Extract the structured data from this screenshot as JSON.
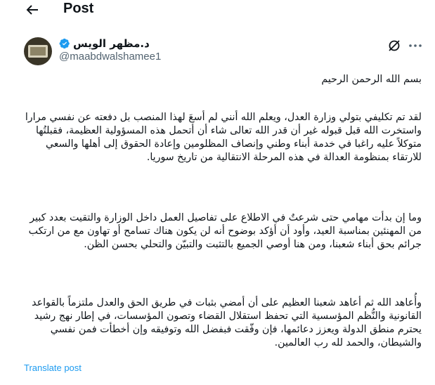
{
  "header": {
    "title": "Post"
  },
  "author": {
    "name": "د.مظهر الويس",
    "handle": "@maabdwalshamee1",
    "verified": true
  },
  "post": {
    "paragraphs": [
      "بسم الله الرحمن الرحيم",
      "لقد تم تكليفي بتولي وزارة العدل، ويعلم الله أنني لم أسعَ لهذا المنصب بل دفعته عن نفسي مرارا واستخرت الله قبل قبوله غير أن قدر الله تعالى شاء أن أتحمل هذه المسؤولية العظيمة، فقبلتُها متوكلاً عليه راغبا في خدمة أبناء وطني وإنصاف المظلومين وإعادة الحقوق إلى أهلها والسعي للارتقاء بمنظومة العدالة في هذه المرحلة الانتقالية من تاريخ سوريا.",
      "وما إن بدأت مهامي حتى شرعتٌ في الاطلاع على تفاصيل العمل داخل الوزارة والتقيت بعدد كبير من المهنئين بمناسبة العيد، وأود أن أؤكد بوضوح أنه لن يكون هناك تسامح أو تهاون مع من ارتكب جرائم بحق أبناء شعبنا، ومن هنا أوصي الجميع بالتثبت والتبيّن والتحلي بحسن الظن.",
      "وأُعاهد الله ثم أعاهد شعبنا العظيم على أن أمضي بثبات في طريق الحق والعدل ملتزماً بالقواعد القانونية والنُّظم المؤسسية التي تحفظ استقلال القضاء وتصون المؤسسات، في إطار نهج رشيد يحترم منطق الدولة ويعزز دعائمها، فإن وفّقت فبفضل الله وتوفيقه وإن أخطأت فمن نفسي والشيطان، والحمد لله رب العالمين."
    ]
  },
  "actions": {
    "translate_label": "Translate post"
  },
  "icons": {
    "back": "arrow-left-icon",
    "verified": "verified-badge-icon",
    "grok": "grok-icon",
    "more": "more-horizontal-icon"
  },
  "colors": {
    "accent": "#1d9bf0",
    "text": "#0f1419",
    "secondary": "#536471"
  }
}
